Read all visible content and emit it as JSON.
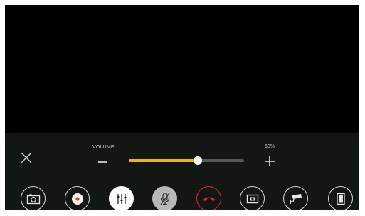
{
  "volume": {
    "label": "VOLUME",
    "percent_text": "60%",
    "level_fraction": 0.6
  },
  "icons": {
    "close": "close-icon",
    "minus": "minus-icon",
    "plus": "plus-icon",
    "camera": "camera-icon",
    "record": "record-icon",
    "equalizer": "equalizer-icon",
    "mic_muted": "mic-muted-icon",
    "hang_up": "phone-hangup-icon",
    "unlock": "unlock-icon",
    "cctv": "cctv-camera-icon",
    "door": "door-icon"
  },
  "colors": {
    "panel_bg": "#131714",
    "accent": "#f2b311",
    "hangup_red": "#e0262a",
    "record_red": "#e23838"
  }
}
